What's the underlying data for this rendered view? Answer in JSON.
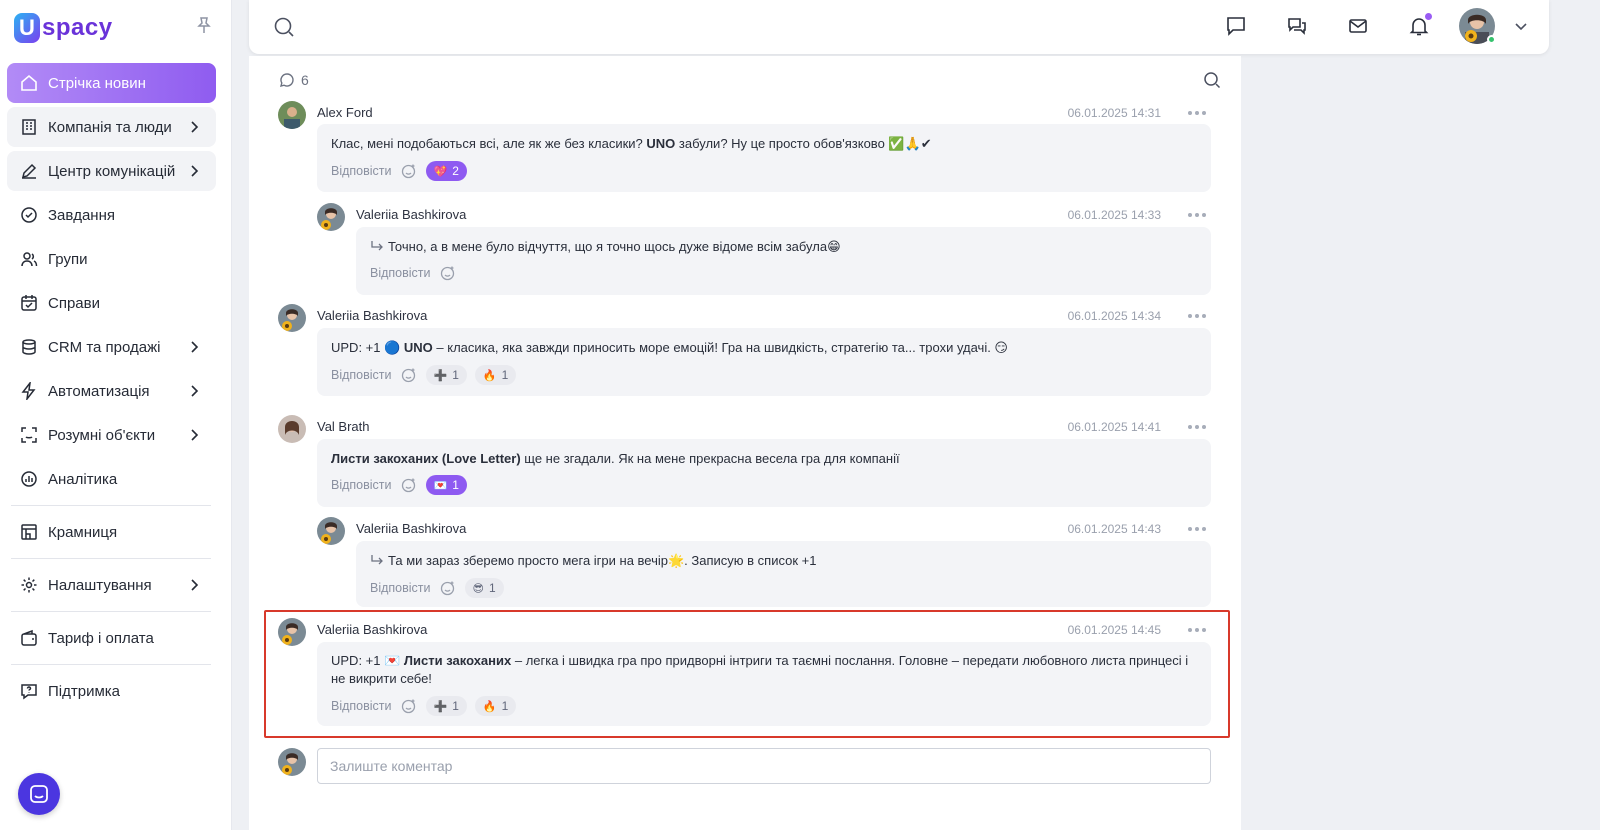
{
  "brand": {
    "logo_letter": "U",
    "logo_text": "spacy"
  },
  "sidebar": {
    "items": [
      {
        "label": "Стрічка новин",
        "icon": "home-icon",
        "active": true
      },
      {
        "label": "Компанія та люди",
        "icon": "building-icon",
        "chevron": true
      },
      {
        "label": "Центр комунікацій",
        "icon": "edit-icon",
        "chevron": true
      },
      {
        "label": "Завдання",
        "icon": "check-circle-icon"
      },
      {
        "label": "Групи",
        "icon": "users-icon"
      },
      {
        "label": "Справи",
        "icon": "calendar-icon"
      },
      {
        "label": "CRM та продажі",
        "icon": "database-icon",
        "chevron": true
      },
      {
        "label": "Автоматизація",
        "icon": "lightning-icon",
        "chevron": true
      },
      {
        "label": "Розумні об'єкти",
        "icon": "scan-icon",
        "chevron": true
      },
      {
        "label": "Аналітика",
        "icon": "chart-icon"
      },
      {
        "label": "Крамниця",
        "icon": "store-icon"
      },
      {
        "label": "Налаштування",
        "icon": "settings-icon",
        "chevron": true
      },
      {
        "label": "Тариф і оплата",
        "icon": "wallet-icon"
      },
      {
        "label": "Підтримка",
        "icon": "help-icon"
      }
    ]
  },
  "topbar": {
    "search_placeholder": ""
  },
  "comments": {
    "count": "6",
    "reply_label": "Відповісти",
    "composer_placeholder": "Залиште коментар",
    "list": [
      {
        "author": "Alex Ford",
        "time": "06.01.2025 14:31",
        "text_pre": "Клас, мені подобаються всі, але як же без класики? ",
        "text_bold": "UNO",
        "text_post": " забули? Ну це просто обов'язково ✅🙏✔",
        "reactions": [
          {
            "emoji": "💖",
            "count": "2"
          }
        ]
      },
      {
        "author": "Valeriia Bashkirova",
        "time": "06.01.2025 14:33",
        "text_pre": "Точно, а в мене було відчуття, що я точно щось дуже відоме всім забула😁",
        "reactions": []
      },
      {
        "author": "Valeriia Bashkirova",
        "time": "06.01.2025 14:34",
        "text_pre": "UPD: +1 🔵 ",
        "text_bold": "UNO",
        "text_post": "  – класика, яка завжди приносить море емоцій! Гра на швидкість, стратегію та... трохи удачі. 😏",
        "reactions": [
          {
            "emoji": "➕",
            "count": "1"
          },
          {
            "emoji": "🔥",
            "count": "1"
          }
        ]
      },
      {
        "author": "Val Brath",
        "time": "06.01.2025 14:41",
        "text_bold": "Листи закоханих (Love Letter)",
        "text_post": " ще не згадали. Як на мене прекрасна весела гра для компанії",
        "reactions": [
          {
            "emoji": "💌",
            "count": "1"
          }
        ]
      },
      {
        "author": "Valeriia Bashkirova",
        "time": "06.01.2025 14:43",
        "text_pre": "Та ми зараз зберемо просто мега ігри на вечір🌟. Записую в список +1",
        "reactions": [
          {
            "emoji": "😎",
            "count": "1"
          }
        ]
      },
      {
        "author": "Valeriia Bashkirova",
        "time": "06.01.2025 14:45",
        "text_pre": " UPD: +1 💌 ",
        "text_bold": "Листи закоханих",
        "text_post": " – легка і швидка гра про придворні інтриги та таємні послання. Головне – передати любовного листа принцесі і не викрити себе!",
        "reactions": [
          {
            "emoji": "➕",
            "count": "1"
          },
          {
            "emoji": "🔥",
            "count": "1"
          }
        ]
      }
    ]
  },
  "colors": {
    "accent": "#8e5af1",
    "highlight": "#d8392b",
    "online": "#35c26d"
  }
}
